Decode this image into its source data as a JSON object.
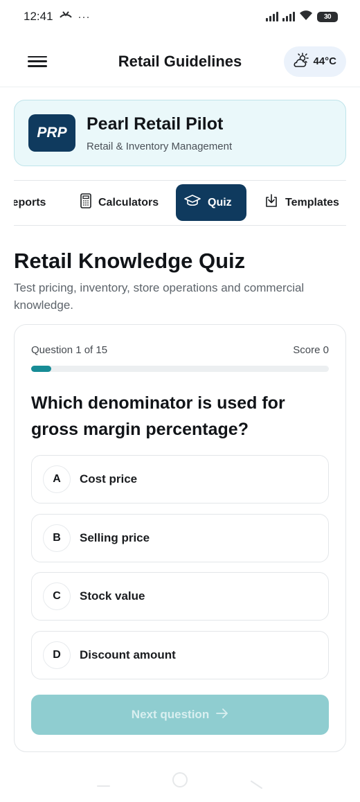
{
  "status": {
    "time": "12:41",
    "battery": "30"
  },
  "header": {
    "title": "Retail Guidelines",
    "temperature": "44°C"
  },
  "brand": {
    "logo_text": "PRP",
    "name": "Pearl Retail Pilot",
    "subtitle": "Retail & Inventory Management"
  },
  "tabs": [
    {
      "label": "Reports",
      "icon": "reports-icon",
      "active": false
    },
    {
      "label": "Calculators",
      "icon": "calculator-icon",
      "active": false
    },
    {
      "label": "Quiz",
      "icon": "graduation-cap-icon",
      "active": true
    },
    {
      "label": "Templates",
      "icon": "download-icon",
      "active": false
    }
  ],
  "section": {
    "title": "Retail Knowledge Quiz",
    "description": "Test pricing, inventory, store operations and commercial knowledge."
  },
  "quiz": {
    "progress_label": "Question 1 of 15",
    "score_label": "Score 0",
    "progress_fraction": 0.067,
    "question": "Which denominator is used for gross margin percentage?",
    "options": [
      {
        "letter": "A",
        "text": "Cost price"
      },
      {
        "letter": "B",
        "text": "Selling price"
      },
      {
        "letter": "C",
        "text": "Stock value"
      },
      {
        "letter": "D",
        "text": "Discount amount"
      }
    ],
    "next_label": "Next question"
  },
  "colors": {
    "primary": "#0f3a5e",
    "accent": "#178c96",
    "next_disabled": "#8fcdd0"
  }
}
